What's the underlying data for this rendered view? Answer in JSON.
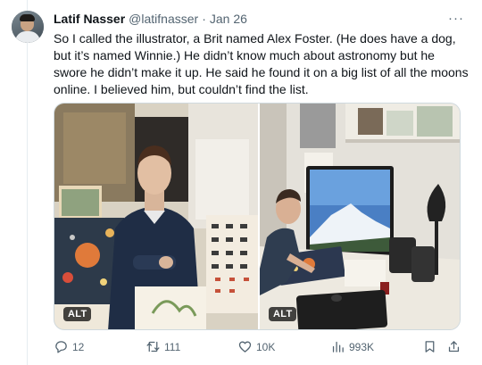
{
  "tweet": {
    "author_name": "Latif Nasser",
    "author_handle": "@latifnasser",
    "separator": "·",
    "date": "Jan 26",
    "more_label": "···",
    "text_lines": [
      "So I called the illustrator, a Brit named Alex Foster. (He does have a dog,",
      "but it’s named Winnie.) He didn’t know much about astronomy but he",
      "swore he didn’t make it up. He said he found it on a big list of all the moons",
      "online. I believed him, but couldn’t find the list."
    ]
  },
  "media": {
    "photos": [
      {
        "alt_badge": "ALT",
        "icon": "photo-illustrator-with-posters"
      },
      {
        "alt_badge": "ALT",
        "icon": "photo-artist-at-desk"
      }
    ]
  },
  "actions": {
    "reply_count": "12",
    "retweet_count": "111",
    "like_count": "10K",
    "view_count": "993K"
  },
  "colors": {
    "text_primary": "#0f1419",
    "text_secondary": "#536471",
    "border": "#cfd9de",
    "background": "#ffffff"
  }
}
